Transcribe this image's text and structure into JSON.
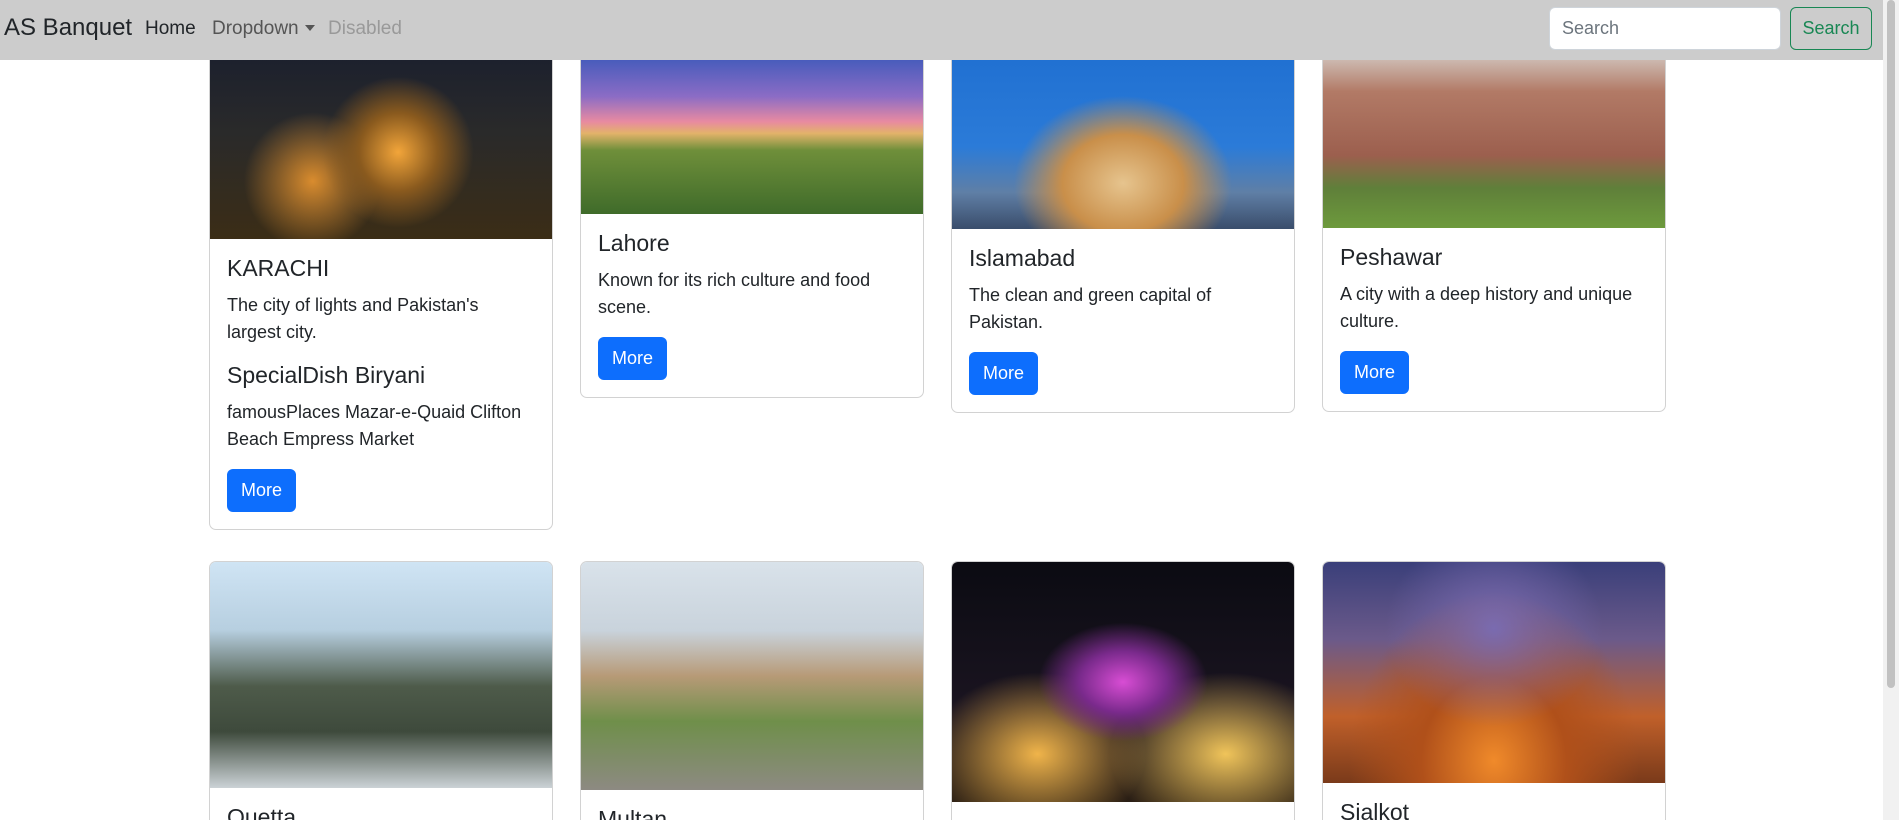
{
  "navbar": {
    "brand": "AS Banquet",
    "links": {
      "home": "Home",
      "dropdown": "Dropdown",
      "disabled": "Disabled"
    },
    "search_placeholder": "Search",
    "search_button": "Search",
    "search_button_color": "#198754"
  },
  "accent_color": "#0d6efd",
  "cards": [
    {
      "title": "KARACHI",
      "text": "The city of lights and Pakistan's largest city.",
      "special_dish": "SpecialDish Biryani",
      "famous_places": "famousPlaces Mazar-e-Quaid Clifton Beach Empress Market",
      "button": "More"
    },
    {
      "title": "Lahore",
      "text": "Known for its rich culture and food scene.",
      "button": "More"
    },
    {
      "title": "Islamabad",
      "text": "The clean and green capital of Pakistan.",
      "button": "More"
    },
    {
      "title": "Peshawar",
      "text": "A city with a deep history and unique culture.",
      "button": "More"
    },
    {
      "title": "Quetta"
    },
    {
      "title": "Multan"
    },
    {
      "title": ""
    },
    {
      "title": "Sialkot"
    }
  ]
}
